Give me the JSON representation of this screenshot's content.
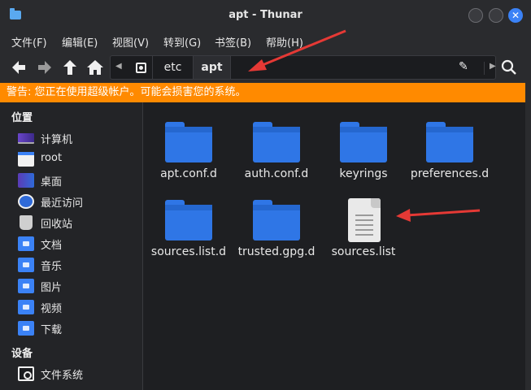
{
  "window": {
    "title": "apt - Thunar"
  },
  "menu": [
    "文件(F)",
    "编辑(E)",
    "视图(V)",
    "转到(G)",
    "书签(B)",
    "帮助(H)"
  ],
  "path": {
    "crumbs": [
      "etc",
      "apt"
    ]
  },
  "warning": "警告: 您正在使用超级帐户。可能会损害您的系统。",
  "sidebar": {
    "places_header": "位置",
    "places": [
      {
        "label": "计算机",
        "icon": "computer-icon"
      },
      {
        "label": "root",
        "icon": "home-folder-icon"
      },
      {
        "label": "桌面",
        "icon": "desktop-icon"
      },
      {
        "label": "最近访问",
        "icon": "recent-icon"
      },
      {
        "label": "回收站",
        "icon": "trash-icon"
      },
      {
        "label": "文档",
        "icon": "documents-folder-icon"
      },
      {
        "label": "音乐",
        "icon": "music-folder-icon"
      },
      {
        "label": "图片",
        "icon": "pictures-folder-icon"
      },
      {
        "label": "视频",
        "icon": "videos-folder-icon"
      },
      {
        "label": "下载",
        "icon": "downloads-folder-icon"
      }
    ],
    "devices_header": "设备",
    "devices": [
      {
        "label": "文件系统",
        "icon": "filesystem-icon"
      }
    ]
  },
  "files": [
    {
      "name": "apt.conf.d",
      "type": "folder"
    },
    {
      "name": "auth.conf.d",
      "type": "folder"
    },
    {
      "name": "keyrings",
      "type": "folder"
    },
    {
      "name": "preferences.d",
      "type": "folder"
    },
    {
      "name": "sources.list.d",
      "type": "folder"
    },
    {
      "name": "trusted.gpg.d",
      "type": "folder"
    },
    {
      "name": "sources.list",
      "type": "file"
    }
  ],
  "colors": {
    "accent": "#3b82f6",
    "warning": "#ff8a00",
    "annotation": "#e53935"
  }
}
